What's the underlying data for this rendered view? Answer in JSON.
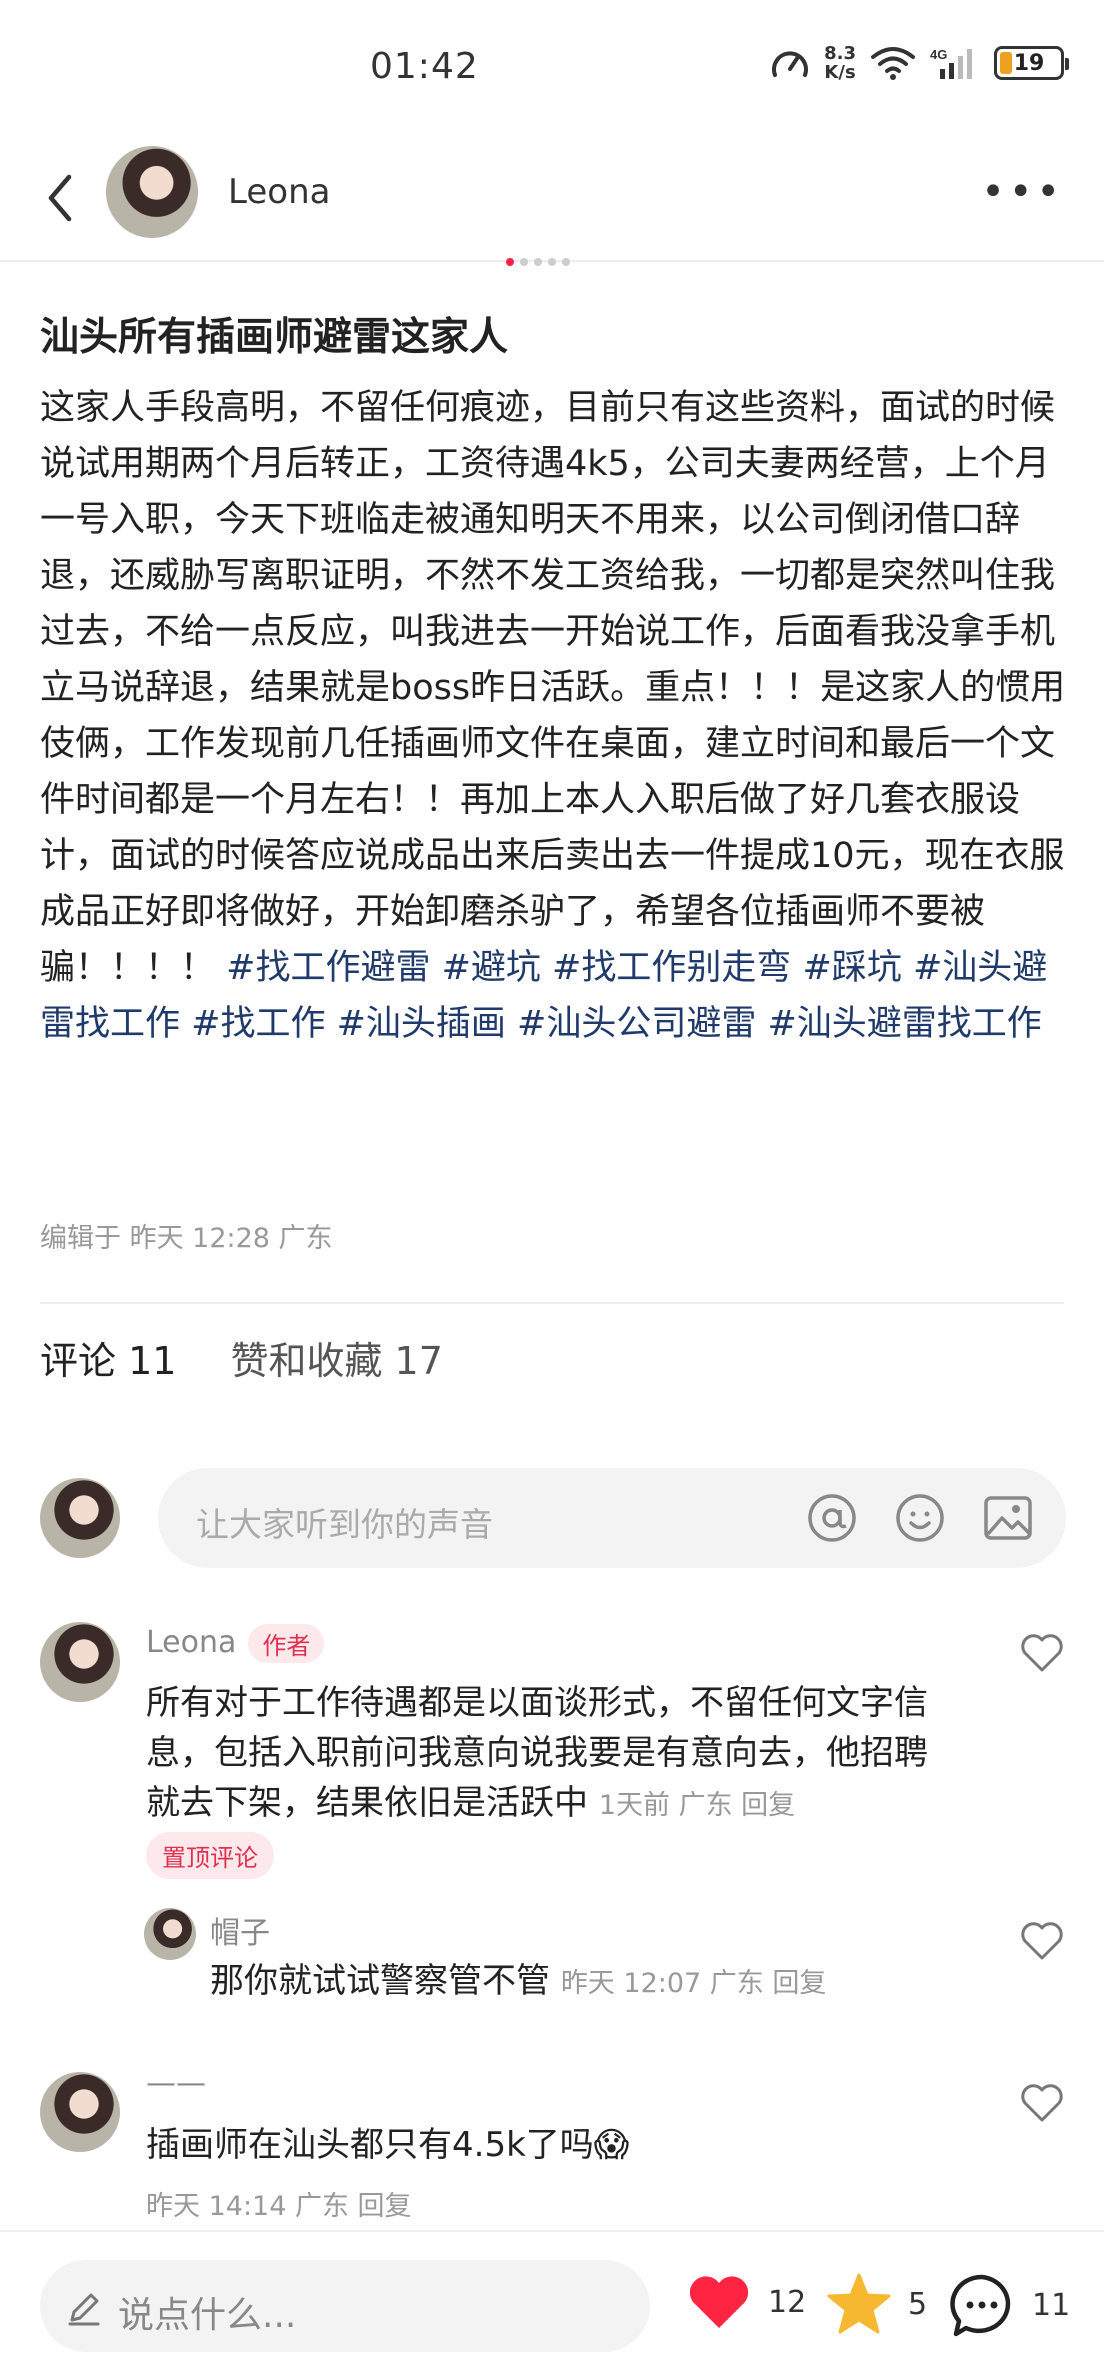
{
  "status_bar": {
    "time": "01:42",
    "net_speed_value": "8.3",
    "net_speed_unit": "K/s",
    "signal_label": "4G",
    "wifi_label": "6",
    "battery": "19"
  },
  "header": {
    "author_name": "Leona",
    "more_label": "•••"
  },
  "post": {
    "title": "汕头所有插画师避雷这家人",
    "body": "这家人手段高明，不留任何痕迹，目前只有这些资料，面试的时候说试用期两个月后转正，工资待遇4k5，公司夫妻两经营，上个月一号入职，今天下班临走被通知明天不用来，以公司倒闭借口辞退，还威胁写离职证明，不然不发工资给我，一切都是突然叫住我过去，不给一点反应，叫我进去一开始说工作，后面看我没拿手机立马说辞退，结果就是boss昨日活跃。重点！！！是这家人的惯用伎俩，工作发现前几任插画师文件在桌面，建立时间和最后一个文件时间都是一个月左右！！再加上本人入职后做了好几套衣服设计，面试的时候答应说成品出来后卖出去一件提成10元，现在衣服成品正好即将做好，开始卸磨杀驴了，希望各位插画师不要被骗！！！！ ",
    "tags": "#找工作避雷 #避坑 #找工作别走弯 #踩坑 #汕头避雷找工作 #找工作 #汕头插画 #汕头公司避雷 #汕头避雷找工作",
    "edit_meta": "编辑于 昨天 12:28 广东"
  },
  "tabs": {
    "comments": "评论 11",
    "likes_favs": "赞和收藏 17"
  },
  "comment_input": {
    "placeholder": "让大家听到你的声音"
  },
  "comments": [
    {
      "name": "Leona",
      "badge": "作者",
      "text": "所有对于工作待遇都是以面谈形式，不留任何文字信息，包括入职前问我意向说我要是有意向去，他招聘就去下架，结果依旧是活跃中",
      "meta": "1天前 广东 回复",
      "pin": "置顶评论"
    },
    {
      "name": "帽子",
      "text": "那你就试试警察管不管",
      "meta": "昨天 12:07 广东 回复"
    },
    {
      "name": "——",
      "text": "插画师在汕头都只有4.5k了吗😱",
      "meta": "昨天 14:14 广东 回复"
    }
  ],
  "bottom_bar": {
    "placeholder": "说点什么...",
    "likes": "12",
    "favorites": "5",
    "comments": "11"
  },
  "colors": {
    "accent": "#ff2442",
    "tag": "#1f3a6b",
    "star": "#f5b830"
  }
}
